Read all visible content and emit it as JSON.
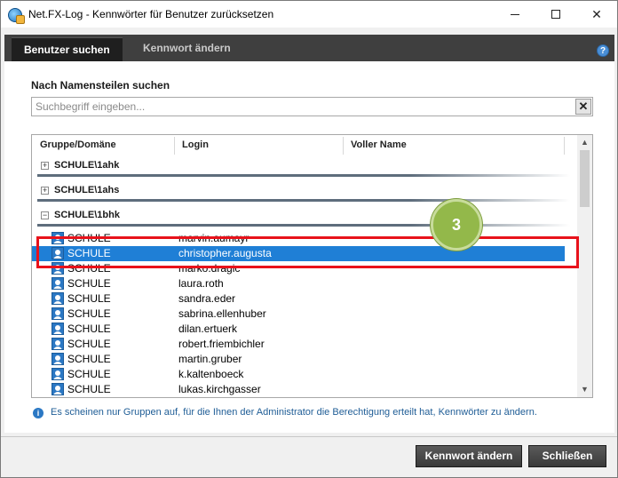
{
  "window": {
    "title": "Net.FX-Log - Kennwörter für Benutzer zurücksetzen",
    "controls": {
      "minimize": "minimize-icon",
      "maximize": "maximize-icon",
      "close": "✕"
    }
  },
  "tabs": [
    {
      "label": "Benutzer suchen",
      "active": true
    },
    {
      "label": "Kennwort ändern",
      "active": false
    }
  ],
  "help": {
    "label": "?"
  },
  "search": {
    "label": "Nach Namensteilen suchen",
    "placeholder": "Suchbegriff eingeben...",
    "value": "",
    "clear_label": "✕"
  },
  "grid": {
    "columns": [
      "Gruppe/Domäne",
      "Login",
      "Voller Name"
    ],
    "groups": [
      {
        "toggle": "+",
        "label": "SCHULE\\1ahk",
        "expanded": false
      },
      {
        "toggle": "+",
        "label": "SCHULE\\1ahs",
        "expanded": false
      },
      {
        "toggle": "−",
        "label": "SCHULE\\1bhk",
        "expanded": true
      }
    ],
    "users": [
      {
        "group": "SCHULE",
        "login": "marvin.aumayr",
        "selected": false
      },
      {
        "group": "SCHULE",
        "login": "christopher.augusta",
        "selected": true
      },
      {
        "group": "SCHULE",
        "login": "marko.dragic",
        "selected": false
      },
      {
        "group": "SCHULE",
        "login": "laura.roth",
        "selected": false
      },
      {
        "group": "SCHULE",
        "login": "sandra.eder",
        "selected": false
      },
      {
        "group": "SCHULE",
        "login": "sabrina.ellenhuber",
        "selected": false
      },
      {
        "group": "SCHULE",
        "login": "dilan.ertuerk",
        "selected": false
      },
      {
        "group": "SCHULE",
        "login": "robert.friembichler",
        "selected": false
      },
      {
        "group": "SCHULE",
        "login": "martin.gruber",
        "selected": false
      },
      {
        "group": "SCHULE",
        "login": "k.kaltenboeck",
        "selected": false
      },
      {
        "group": "SCHULE",
        "login": "lukas.kirchgasser",
        "selected": false
      }
    ]
  },
  "annotation": {
    "step": "3",
    "color": "#93b84a",
    "highlight_color": "#e8121b"
  },
  "info": {
    "icon": "i",
    "text": "Es scheinen nur Gruppen auf, für die Ihnen der Administrator die Berechtigung erteilt hat, Kennwörter zu ändern."
  },
  "footer": {
    "change_label": "Kennwort ändern",
    "close_label": "Schließen"
  },
  "colors": {
    "selection": "#1f7fd6",
    "tabbar": "#3f3f3f",
    "info_text": "#1f5d96"
  }
}
